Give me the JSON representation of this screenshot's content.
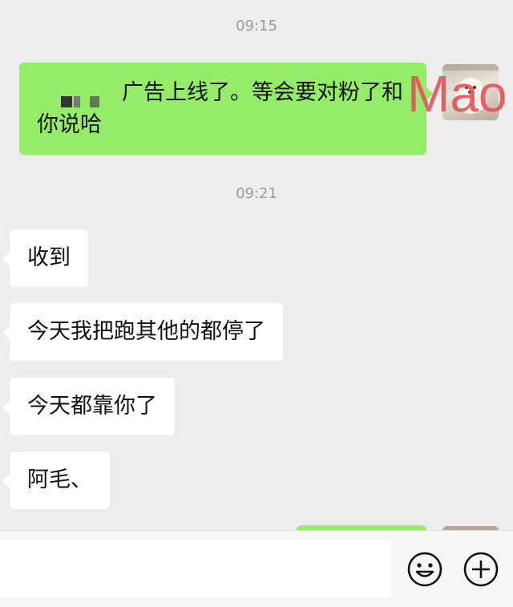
{
  "timestamps": [
    "09:15",
    "09:21"
  ],
  "sent_message": {
    "text_line1": "广告上线了。等会要对粉了和",
    "text_line2": "你说哈"
  },
  "avatar_watermark": "Mao",
  "received_messages": [
    "收到",
    "今天我把跑其他的都停了",
    "今天都靠你了",
    "阿毛、"
  ],
  "composer": {
    "input_placeholder": "",
    "emoji_icon": "smiley-face-icon",
    "plus_icon": "plus-circle-icon"
  },
  "colors": {
    "background": "#ededed",
    "outgoing_bubble": "#95ec69",
    "incoming_bubble": "#ffffff",
    "timestamp": "#9b9b9b",
    "watermark": "#e8505a"
  }
}
